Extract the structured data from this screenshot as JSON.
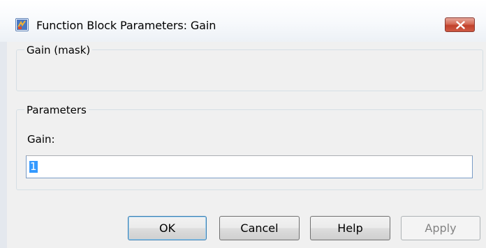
{
  "window": {
    "title": "Function Block Parameters: Gain",
    "app_icon": "simulink-block-icon",
    "close_icon": "close-icon"
  },
  "mask_group": {
    "legend": "Gain (mask)"
  },
  "parameters_group": {
    "legend": "Parameters",
    "gain_label": "Gain:",
    "gain_value": "1"
  },
  "buttons": {
    "ok": "OK",
    "cancel": "Cancel",
    "help": "Help",
    "apply": "Apply"
  },
  "colors": {
    "close_button": "#c7432d",
    "selection": "#3399ff",
    "window_bg": "#f0f0f0"
  }
}
